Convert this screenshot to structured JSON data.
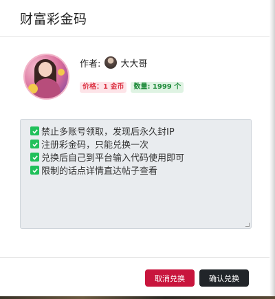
{
  "dialog": {
    "title": "财富彩金码"
  },
  "product": {
    "cover_icon": "cover-image",
    "author_label": "作者:",
    "author_name": "大大哥",
    "price_badge": "价格：1 金币",
    "quantity_badge": "数量: 1999 个",
    "colors": {
      "price": "#dc3545",
      "quantity": "#1e8a3a"
    }
  },
  "notice": {
    "lines": [
      "禁止多账号领取，发现后永久封IP",
      "注册彩金码，只能兑换一次",
      "兑换后自己到平台输入代码使用即可",
      "限制的话点详情直达帖子查看"
    ],
    "check_icon": "check-box-icon"
  },
  "footer": {
    "cancel_label": "取消兑换",
    "confirm_label": "确认兑换",
    "colors": {
      "cancel": "#c8153d",
      "confirm": "#212529"
    }
  }
}
